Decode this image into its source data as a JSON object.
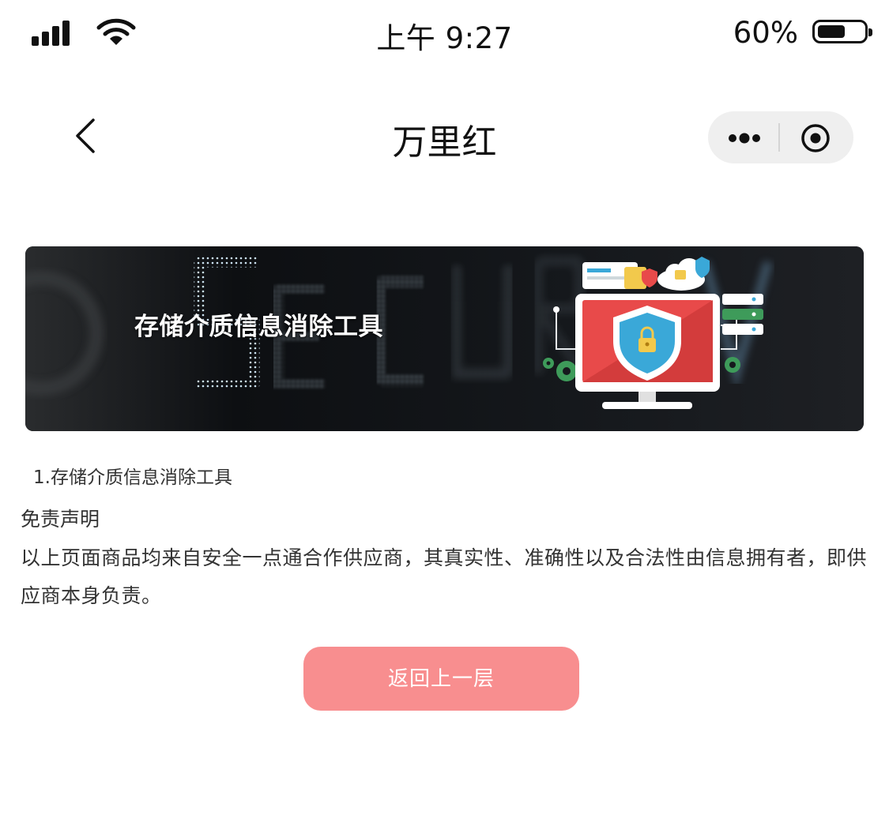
{
  "status_bar": {
    "time": "上午 9:27",
    "battery_percent": "60%",
    "battery_level": 0.6
  },
  "navbar": {
    "title": "万里红"
  },
  "banner": {
    "caption": "存储介质信息消除工具",
    "background_word": "SECURITY"
  },
  "content": {
    "item_title": "1.存储介质信息消除工具",
    "disclaimer_title": "免责声明",
    "disclaimer_body": "以上页面商品均来自安全一点通合作供应商，其真实性、准确性以及合法性由信息拥有者，即供应商本身负责。"
  },
  "actions": {
    "back_button_label": "返回上一层"
  },
  "colors": {
    "button_bg": "#f88e8f",
    "capsule_bg": "#efefef",
    "monitor_red": "#e84a4a",
    "shield_blue": "#3aa8d8"
  }
}
